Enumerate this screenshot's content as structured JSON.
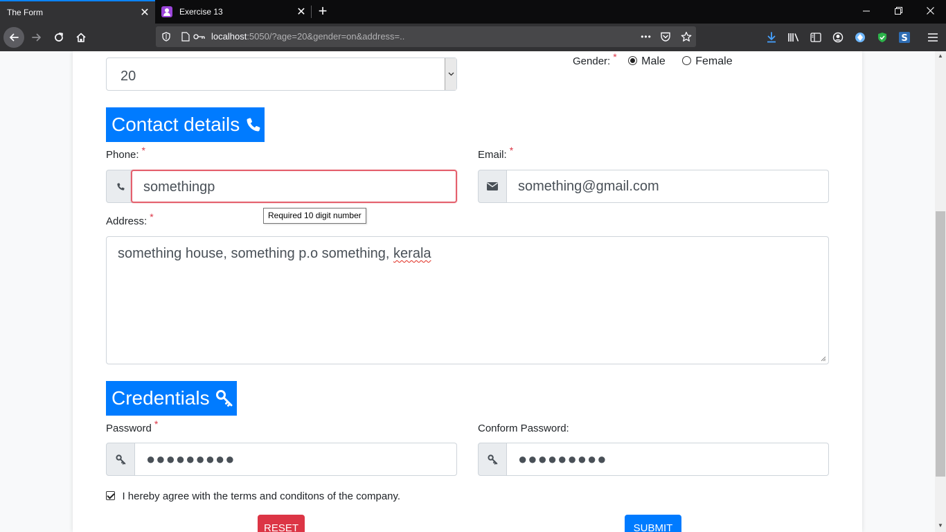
{
  "browser": {
    "tabs": [
      {
        "title": "The Form",
        "active": true
      },
      {
        "title": "Exercise 13",
        "active": false
      }
    ],
    "new_tab": "+",
    "window_controls": {
      "minimize": "—",
      "restore": "❐",
      "close": "✕"
    },
    "url_host": "localhost",
    "url_rest": ":5050/?age=20&gender=on&address=..",
    "url_more": "•••"
  },
  "form": {
    "age_value": "20",
    "gender": {
      "label": "Gender:",
      "required_mark": "*",
      "options": [
        {
          "label": "Male",
          "selected": true
        },
        {
          "label": "Female",
          "selected": false
        }
      ]
    },
    "contact_section": {
      "title": "Contact details",
      "icon": "phone-icon"
    },
    "phone": {
      "label": "Phone:",
      "required_mark": "*",
      "value": "somethingp",
      "tooltip": "Required 10 digit number"
    },
    "email": {
      "label": "Email:",
      "required_mark": "*",
      "value": "something@gmail.com"
    },
    "address": {
      "label": "Address:",
      "required_mark": "*",
      "value_prefix": "something house, something p.o something, ",
      "value_misspelled": "kerala"
    },
    "credentials_section": {
      "title": "Credentials",
      "icon": "key-icon"
    },
    "password": {
      "label": "Password",
      "required_mark": "*",
      "masked": "●●●●●●●●●"
    },
    "confirm_password": {
      "label": "Conform Password:",
      "masked": "●●●●●●●●●"
    },
    "terms": {
      "label": "I hereby agree with the terms and conditons of the company.",
      "checked": true
    },
    "reset_label": "RESET",
    "submit_label": "SUBMIT"
  },
  "colors": {
    "primary": "#007bff",
    "danger": "#dc3545",
    "invalid_border": "#e4606d",
    "chrome_dark": "#0c0c0d",
    "toolbar": "#323234"
  }
}
